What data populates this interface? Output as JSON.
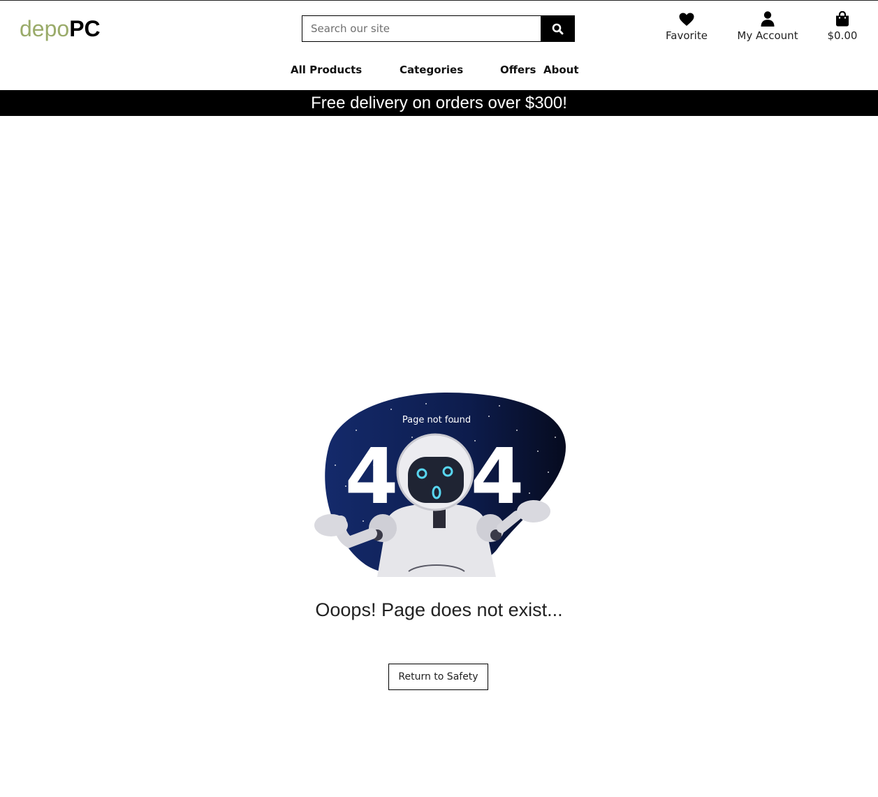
{
  "header": {
    "logo": {
      "part1": "depo",
      "part2": "PC"
    },
    "search": {
      "placeholder": "Search our site",
      "value": "",
      "icon": "search-icon"
    },
    "links": [
      {
        "label": "Favorite",
        "icon": "heart-icon"
      },
      {
        "label": "My Account",
        "icon": "user-icon"
      },
      {
        "label": "$0.00",
        "icon": "shopping-bag-icon"
      }
    ]
  },
  "nav": {
    "items": [
      {
        "label": "All Products"
      },
      {
        "label": "Categories"
      },
      {
        "label": "Offers"
      },
      {
        "label": "About"
      }
    ]
  },
  "banner": {
    "text": "Free delivery on orders over $300!"
  },
  "main": {
    "illustration": {
      "caption": "Page not found",
      "code_left": "4",
      "code_right": "4",
      "icon": "robot-404-illustration"
    },
    "message": "Ooops! Page does not exist...",
    "button": "Return to Safety"
  },
  "colors": {
    "logo_accent": "#9aab6a",
    "banner_bg": "#000000",
    "illustration_bg": "#0e1f54"
  }
}
